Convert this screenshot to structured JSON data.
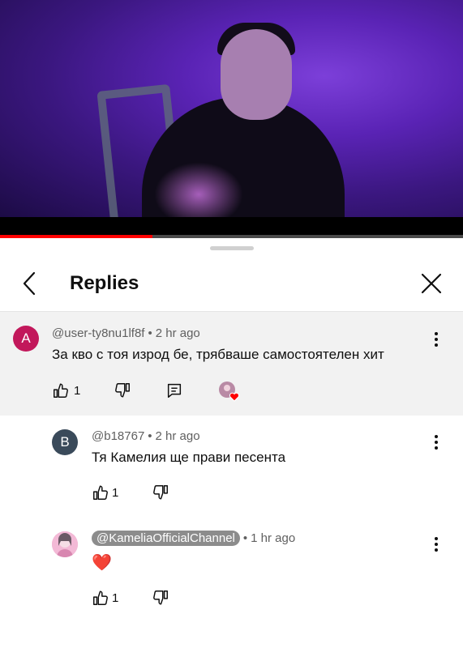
{
  "header": {
    "title": "Replies"
  },
  "video": {
    "progress": 0.33
  },
  "colors": {
    "progress_fill": "#ff0000",
    "avatar_a": "#c2185b",
    "avatar_b": "#3a4a5a",
    "highlight_bg": "#f2f2f2"
  },
  "comments": [
    {
      "avatar_letter": "A",
      "author": "@user-ty8nu1lf8f",
      "time": "2 hr ago",
      "text": "За кво с тоя изрод бе, трябваше самостоятелен хит",
      "likes": "1",
      "icons": [
        "thumbs-up-icon",
        "thumbs-down-icon",
        "reply-icon",
        "creator-heart-icon"
      ]
    },
    {
      "avatar_letter": "B",
      "author": "@b18767",
      "time": "2 hr ago",
      "text": "Тя Камелия ще прави песента",
      "likes": "1"
    },
    {
      "author": "@KameliaOfficialChannel",
      "time": "1 hr ago",
      "text": "❤️",
      "likes": "1"
    }
  ]
}
